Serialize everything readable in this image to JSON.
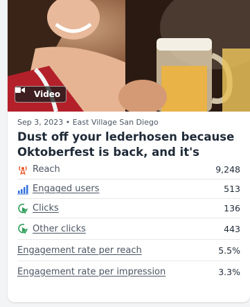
{
  "post": {
    "media_badge": "Video",
    "meta": "Sep 3, 2023 • East Village San Diego",
    "title": "Dust off your lederhosen because Oktoberfest is back, and it's bigger…"
  },
  "metrics": [
    {
      "label": "Reach",
      "value": "9,248",
      "icon": "broadcast-icon",
      "linked": false
    },
    {
      "label": "Engaged users",
      "value": "513",
      "icon": "bar-chart-icon",
      "linked": true
    },
    {
      "label": "Clicks",
      "value": "136",
      "icon": "cursor-click-icon",
      "linked": true
    },
    {
      "label": "Other clicks",
      "value": "443",
      "icon": "cursor-click-icon",
      "linked": true
    },
    {
      "label": "Engagement rate per reach",
      "value": "5.5%",
      "icon": "",
      "linked": true
    },
    {
      "label": "Engagement rate per impression",
      "value": "3.3%",
      "icon": "",
      "linked": true
    }
  ],
  "colors": {
    "reach_icon": "#e8572a",
    "engaged_icon": "#2f6fde",
    "clicks_icon": "#2f9e5b"
  }
}
